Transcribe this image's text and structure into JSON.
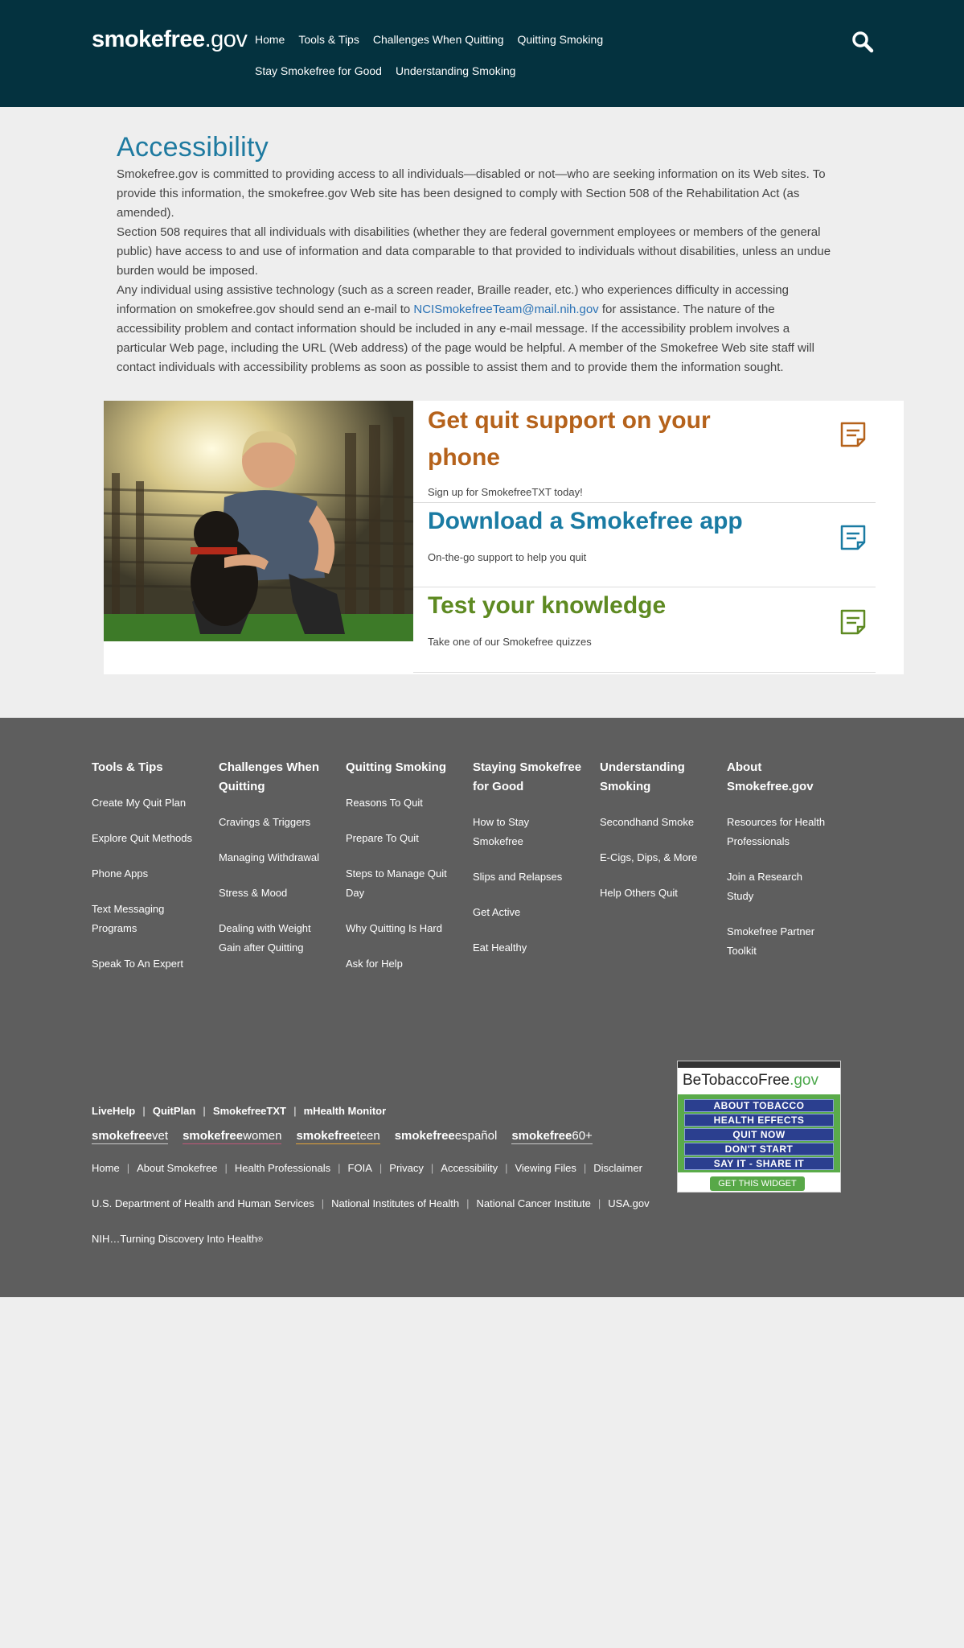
{
  "header": {
    "logo_bold": "smokefree",
    "logo_suffix": ".gov",
    "nav": [
      "Home",
      "Tools & Tips",
      "Challenges When Quitting",
      "Quitting Smoking",
      "Stay Smokefree for Good",
      "Understanding Smoking"
    ]
  },
  "main": {
    "title": "Accessibility",
    "p1": "Smokefree.gov is committed to providing access to all individuals—disabled or not—who are seeking information on its Web sites. To provide this information, the smokefree.gov Web site has been designed to comply with Section 508 of the Rehabilitation Act (as amended).",
    "p2": "Section 508 requires that all individuals with disabilities (whether they are federal government employees or members of the general public) have access to and use of information and data comparable to that provided to individuals without disabilities, unless an undue burden would be imposed.",
    "p3_pre": "Any individual using assistive technology (such as a screen reader, Braille reader, etc.) who experiences difficulty in accessing information on smokefree.gov should send an e-mail to ",
    "p3_link": "NCISmokefreeTeam@mail.nih.gov",
    "p3_post": " for assistance. The nature of the accessibility problem and contact information should be included in any e-mail message. If the accessibility problem involves a particular Web page, including the URL (Web address) of the page would be helpful. A member of the Smokefree Web site staff will contact individuals with accessibility problems as soon as possible to assist them and to provide them the information sought."
  },
  "promo": {
    "items": [
      {
        "title": "Get quit support on your phone",
        "desc": "Sign up for SmokefreeTXT today!",
        "color": "#b5621b"
      },
      {
        "title": "Download a Smokefree app",
        "desc": "On-the-go support to help you quit",
        "color": "#1a7ba3"
      },
      {
        "title": "Test your knowledge",
        "desc": "Take one of our Smokefree quizzes",
        "color": "#5e8a22"
      }
    ]
  },
  "footer": {
    "columns": [
      {
        "heading": "Tools & Tips",
        "links": [
          "Create My Quit Plan",
          "Explore Quit Methods",
          "Phone Apps",
          "Text Messaging Programs",
          "Speak To An Expert"
        ]
      },
      {
        "heading": "Challenges When Quitting",
        "links": [
          "Cravings & Triggers",
          "Managing Withdrawal",
          "Stress & Mood",
          "Dealing with Weight Gain after Quitting"
        ]
      },
      {
        "heading": "Quitting Smoking",
        "links": [
          "Reasons To Quit",
          "Prepare To Quit",
          "Steps to Manage Quit Day",
          "Why Quitting Is Hard",
          "Ask for Help"
        ]
      },
      {
        "heading": "Staying Smokefree for Good",
        "links": [
          "How to Stay Smokefree",
          "Slips and Relapses",
          "Get Active",
          "Eat Healthy"
        ]
      },
      {
        "heading": "Understanding Smoking",
        "links": [
          "Secondhand Smoke",
          "E-Cigs, Dips, & More",
          "Help Others Quit"
        ]
      },
      {
        "heading": "About Smokefree.gov",
        "links": [
          "Resources for Health Professionals",
          "Join a Research Study",
          "Smokefree Partner Toolkit"
        ]
      }
    ],
    "bold_links": [
      "LiveHelp",
      "QuitPlan",
      "SmokefreeTXT",
      "mHealth Monitor"
    ],
    "brands": [
      {
        "bold": "smokefree",
        "suffix": "vet",
        "underline": "#cccccc"
      },
      {
        "bold": "smokefree",
        "suffix": "women",
        "underline": "#c0577a"
      },
      {
        "bold": "smokefree",
        "suffix": "teen",
        "underline": "#e3a43a"
      },
      {
        "bold": "smokefree",
        "suffix": "español",
        "underline": "#5e5e5e"
      },
      {
        "bold": "smokefree",
        "suffix": "60+",
        "underline": "#cccccc"
      }
    ],
    "site_links": [
      "Home",
      "About Smokefree",
      "Health Professionals",
      "FOIA",
      "Privacy",
      "Accessibility",
      "Viewing Files",
      "Disclaimer"
    ],
    "gov_links": [
      "U.S. Department of Health and Human Services",
      "National Institutes of Health",
      "National Cancer Institute",
      "USA.gov"
    ],
    "tagline": "NIH…Turning Discovery Into Health",
    "tagline_mark": "®"
  },
  "widget": {
    "title_main": "BeTobaccoFree",
    "title_suffix": ".gov",
    "buttons": [
      "ABOUT TOBACCO",
      "HEALTH EFFECTS",
      "QUIT NOW",
      "DON'T START",
      "SAY IT - SHARE IT"
    ],
    "get_label": "GET THIS WIDGET"
  }
}
